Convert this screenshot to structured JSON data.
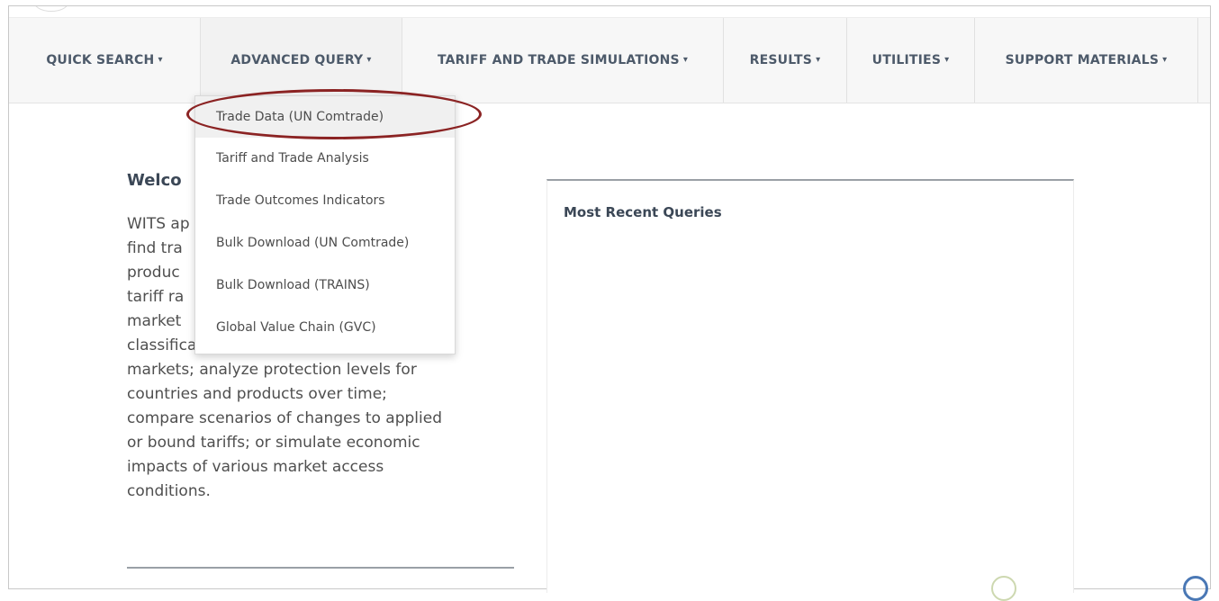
{
  "nav": {
    "items": [
      {
        "label": "QUICK SEARCH",
        "caret": "▾"
      },
      {
        "label": "ADVANCED QUERY",
        "caret": "▾"
      },
      {
        "label": "TARIFF AND TRADE SIMULATIONS",
        "caret": "▾"
      },
      {
        "label": "RESULTS",
        "caret": "▾"
      },
      {
        "label": "UTILITIES",
        "caret": "▾"
      },
      {
        "label": "SUPPORT MATERIALS",
        "caret": "▾"
      }
    ]
  },
  "dropdown": {
    "items": [
      {
        "label": "Trade Data (UN Comtrade)"
      },
      {
        "label": "Tariff and Trade Analysis"
      },
      {
        "label": "Trade Outcomes Indicators"
      },
      {
        "label": "Bulk Download (UN Comtrade)"
      },
      {
        "label": "Bulk Download (TRAINS)"
      },
      {
        "label": "Global Value Chain (GVC)"
      }
    ]
  },
  "welcome": {
    "title": "Welco",
    "lines": [
      "WITS ap                                    ers",
      "find tra",
      "produc                                     find",
      "tariff ra",
      "market",
      "classifications; compare tariffs across",
      "markets; analyze protection levels for",
      "countries and products over time;",
      "compare scenarios of changes to applied",
      "or bound tariffs; or simulate economic",
      "impacts of various market access",
      "conditions."
    ]
  },
  "recent": {
    "title": "Most Recent Queries"
  },
  "colors": {
    "nav_bg": "#f7f7f7",
    "nav_text": "#4d5a6a",
    "highlight_ellipse": "#8b2323"
  }
}
